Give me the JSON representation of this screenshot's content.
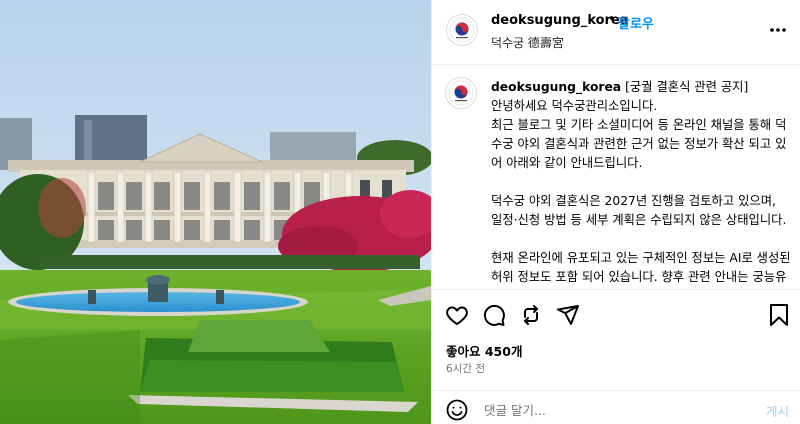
{
  "post": {
    "username": "deoksugung_korea",
    "dot": "•",
    "follow_label": "팔로우",
    "location": "덕수궁 德壽宮"
  },
  "caption": {
    "username": "deoksugung_korea",
    "lines": [
      "[궁궐 결혼식 관련 공지]",
      "안녕하세요 덕수궁관리소입니다.",
      "최근 블로그 및 기타 소셜미디어 등 온라인 채널을 통해 덕수궁 야외 결혼식과 관련한 근거 없는 정보가 확산 되고 있어 아래와 같이 안내드립니다.",
      "덕수궁 야외 결혼식은 2027년 진행을 검토하고 있으며, 일정·신청 방법 등 세부 계획은 수립되지 않은 상태입니다.",
      "현재 온라인에 유포되고 있는 구체적인 정보는 AI로 생성된 허위 정보도 포함 되어 있습니다. 향후 관련 안내는 궁능유적본부 누리집을 통해서만 공개될 예정이"
    ]
  },
  "stats": {
    "likes": "좋아요 450개",
    "time": "6시간 전"
  },
  "comment": {
    "placeholder": "댓글 달기...",
    "post_label": "게시"
  },
  "icons": {
    "more": "more-options-icon",
    "like": "heart-icon",
    "comment": "comment-bubble-icon",
    "repost": "repost-icon",
    "share": "paper-plane-icon",
    "save": "bookmark-icon",
    "emoji": "emoji-smile-icon"
  },
  "colors": {
    "accent": "#0095f6",
    "secondary_text": "#737373",
    "post_disabled": "#a8cdf3"
  }
}
